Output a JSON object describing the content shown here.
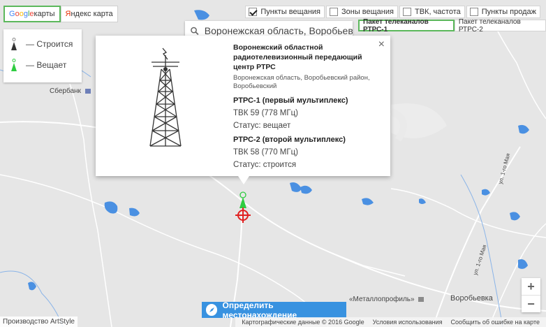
{
  "provider_tabs": [
    {
      "google_letters": [
        "G",
        "o",
        "o",
        "g",
        "l",
        "e"
      ],
      "suffix": " карты"
    },
    {
      "yandex_first": "Я",
      "yandex_rest": "ндекс карта"
    }
  ],
  "legend": {
    "building_label": "— Строится",
    "broadcasting_label": "— Вещает"
  },
  "layers": [
    {
      "label": "Пункты вещания",
      "checked": true
    },
    {
      "label": "Зоны вещания",
      "checked": false
    },
    {
      "label": "ТВК, частота",
      "checked": false
    },
    {
      "label": "Пункты продаж",
      "checked": false
    }
  ],
  "search": {
    "value": "Воронежская область, Воробьевс…"
  },
  "package_tabs": [
    {
      "label": "Пакет телеканалов РТРС-1"
    },
    {
      "label": "Пакет телеканалов РТРС-2"
    }
  ],
  "info": {
    "title": "Воронежский областной радиотелевизионный передающий центр РТРС",
    "address": "Воронежская область, Воробьевский район, Воробьевский",
    "close": "×",
    "muxes": [
      {
        "name": "РТРС-1 (первый мультиплекс)",
        "channel": "ТВК 59 (778 МГц)",
        "status": "Статус: вещает"
      },
      {
        "name": "РТРС-2 (второй мультиплекс)",
        "channel": "ТВК 58 (770 МГц)",
        "status": "Статус: строится"
      }
    ]
  },
  "map_labels": {
    "sberbank": "Сбербанк",
    "metalloprofil": "«Металлопрофиль»",
    "vorobyevka": "Воробьевка",
    "street_1": "ул. 1-го Мая",
    "street_2": "ул. 1-го Мая"
  },
  "zoom": {
    "in": "+",
    "out": "−"
  },
  "locate_label": "Определить местонахождение",
  "credit": "Производство ArtStyle",
  "attribution": {
    "data": "Картографические данные © 2016 Google",
    "terms": "Условия использования",
    "report": "Сообщить об ошибке на карте"
  },
  "colors": {
    "land": "#e5e3df",
    "water": "#4a90e2",
    "road": "#ffffff",
    "active_border": "#5cb85c",
    "locate_button": "#3892e0",
    "marker_red": "#e02020",
    "tower_green": "#2ecc40"
  }
}
